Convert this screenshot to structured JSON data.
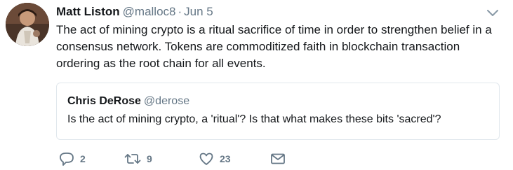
{
  "tweet": {
    "author": {
      "display_name": "Matt Liston",
      "handle": "@malloc8"
    },
    "separator": "·",
    "date": "Jun 5",
    "text": "The act of mining crypto is a ritual sacrifice of time in order to strengthen belief in a consensus network. Tokens are commoditized faith in blockchain transaction ordering as the root chain for all events.",
    "menu_icon": "chevron-down-icon",
    "avatar_icon": "avatar"
  },
  "quoted_tweet": {
    "display_name": "Chris DeRose",
    "handle": "@derose",
    "text": "Is the act of mining crypto, a 'ritual'? Is that what makes these bits 'sacred'?"
  },
  "actions": {
    "reply": {
      "icon": "reply-icon",
      "count": "2"
    },
    "retweet": {
      "icon": "retweet-icon",
      "count": "9"
    },
    "like": {
      "icon": "heart-icon",
      "count": "23"
    },
    "direct_message": {
      "icon": "envelope-icon"
    }
  },
  "colors": {
    "text_primary": "#14171a",
    "text_secondary": "#657786",
    "border": "#e1e8ed"
  }
}
